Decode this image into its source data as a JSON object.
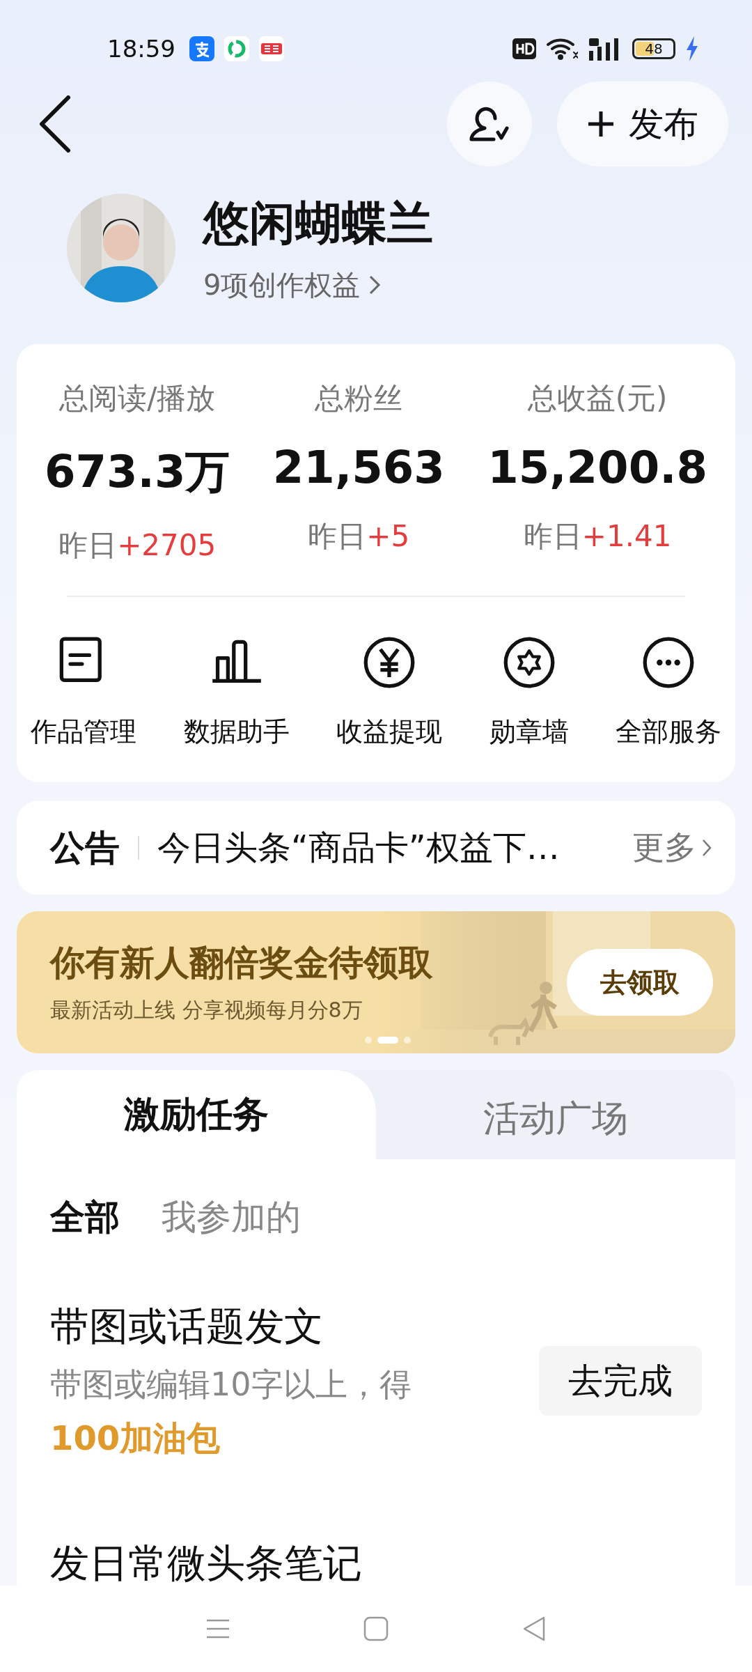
{
  "status_bar": {
    "time": "18:59",
    "battery": "48",
    "charging": true
  },
  "header": {
    "publish_button": "发布"
  },
  "profile": {
    "name": "悠闲蝴蝶兰",
    "benefits": "9项创作权益"
  },
  "stats": [
    {
      "label": "总阅读/播放",
      "value": "673.3万",
      "yesterday": "昨日",
      "change": "+2705"
    },
    {
      "label": "总粉丝",
      "value": "21,563",
      "yesterday": "昨日",
      "change": "+5"
    },
    {
      "label": "总收益(元)",
      "value": "15,200.8",
      "yesterday": "昨日",
      "change": "+1.41"
    }
  ],
  "services": [
    {
      "label": "作品管理",
      "kind": "document"
    },
    {
      "label": "数据助手",
      "kind": "chart"
    },
    {
      "label": "收益提现",
      "kind": "yuan"
    },
    {
      "label": "勋章墙",
      "kind": "medal"
    },
    {
      "label": "全部服务",
      "kind": "more"
    }
  ],
  "notice": {
    "label": "公告",
    "text": "今日头条“商品卡”权益下…",
    "more": "更多"
  },
  "banner": {
    "title": "你有新人翻倍奖金待领取",
    "subtitle": "最新活动上线 分享视频每月分8万",
    "button": "去领取",
    "kind": "picture",
    "dots": [
      {
        "selected": false
      },
      {
        "selected": true
      },
      {
        "selected": false
      }
    ]
  },
  "tabs": [
    {
      "label": "激励任务",
      "selected": true
    },
    {
      "label": "活动广场",
      "selected": false
    }
  ],
  "filters": [
    {
      "label": "全部",
      "selected": true
    },
    {
      "label": "我参加的",
      "selected": false
    }
  ],
  "tasks": [
    {
      "title": "带图或话题发文",
      "description": "带图或编辑10字以上，得",
      "reward": "100加油包",
      "button": "去完成"
    },
    {
      "title": "发日常微头条笔记"
    }
  ]
}
